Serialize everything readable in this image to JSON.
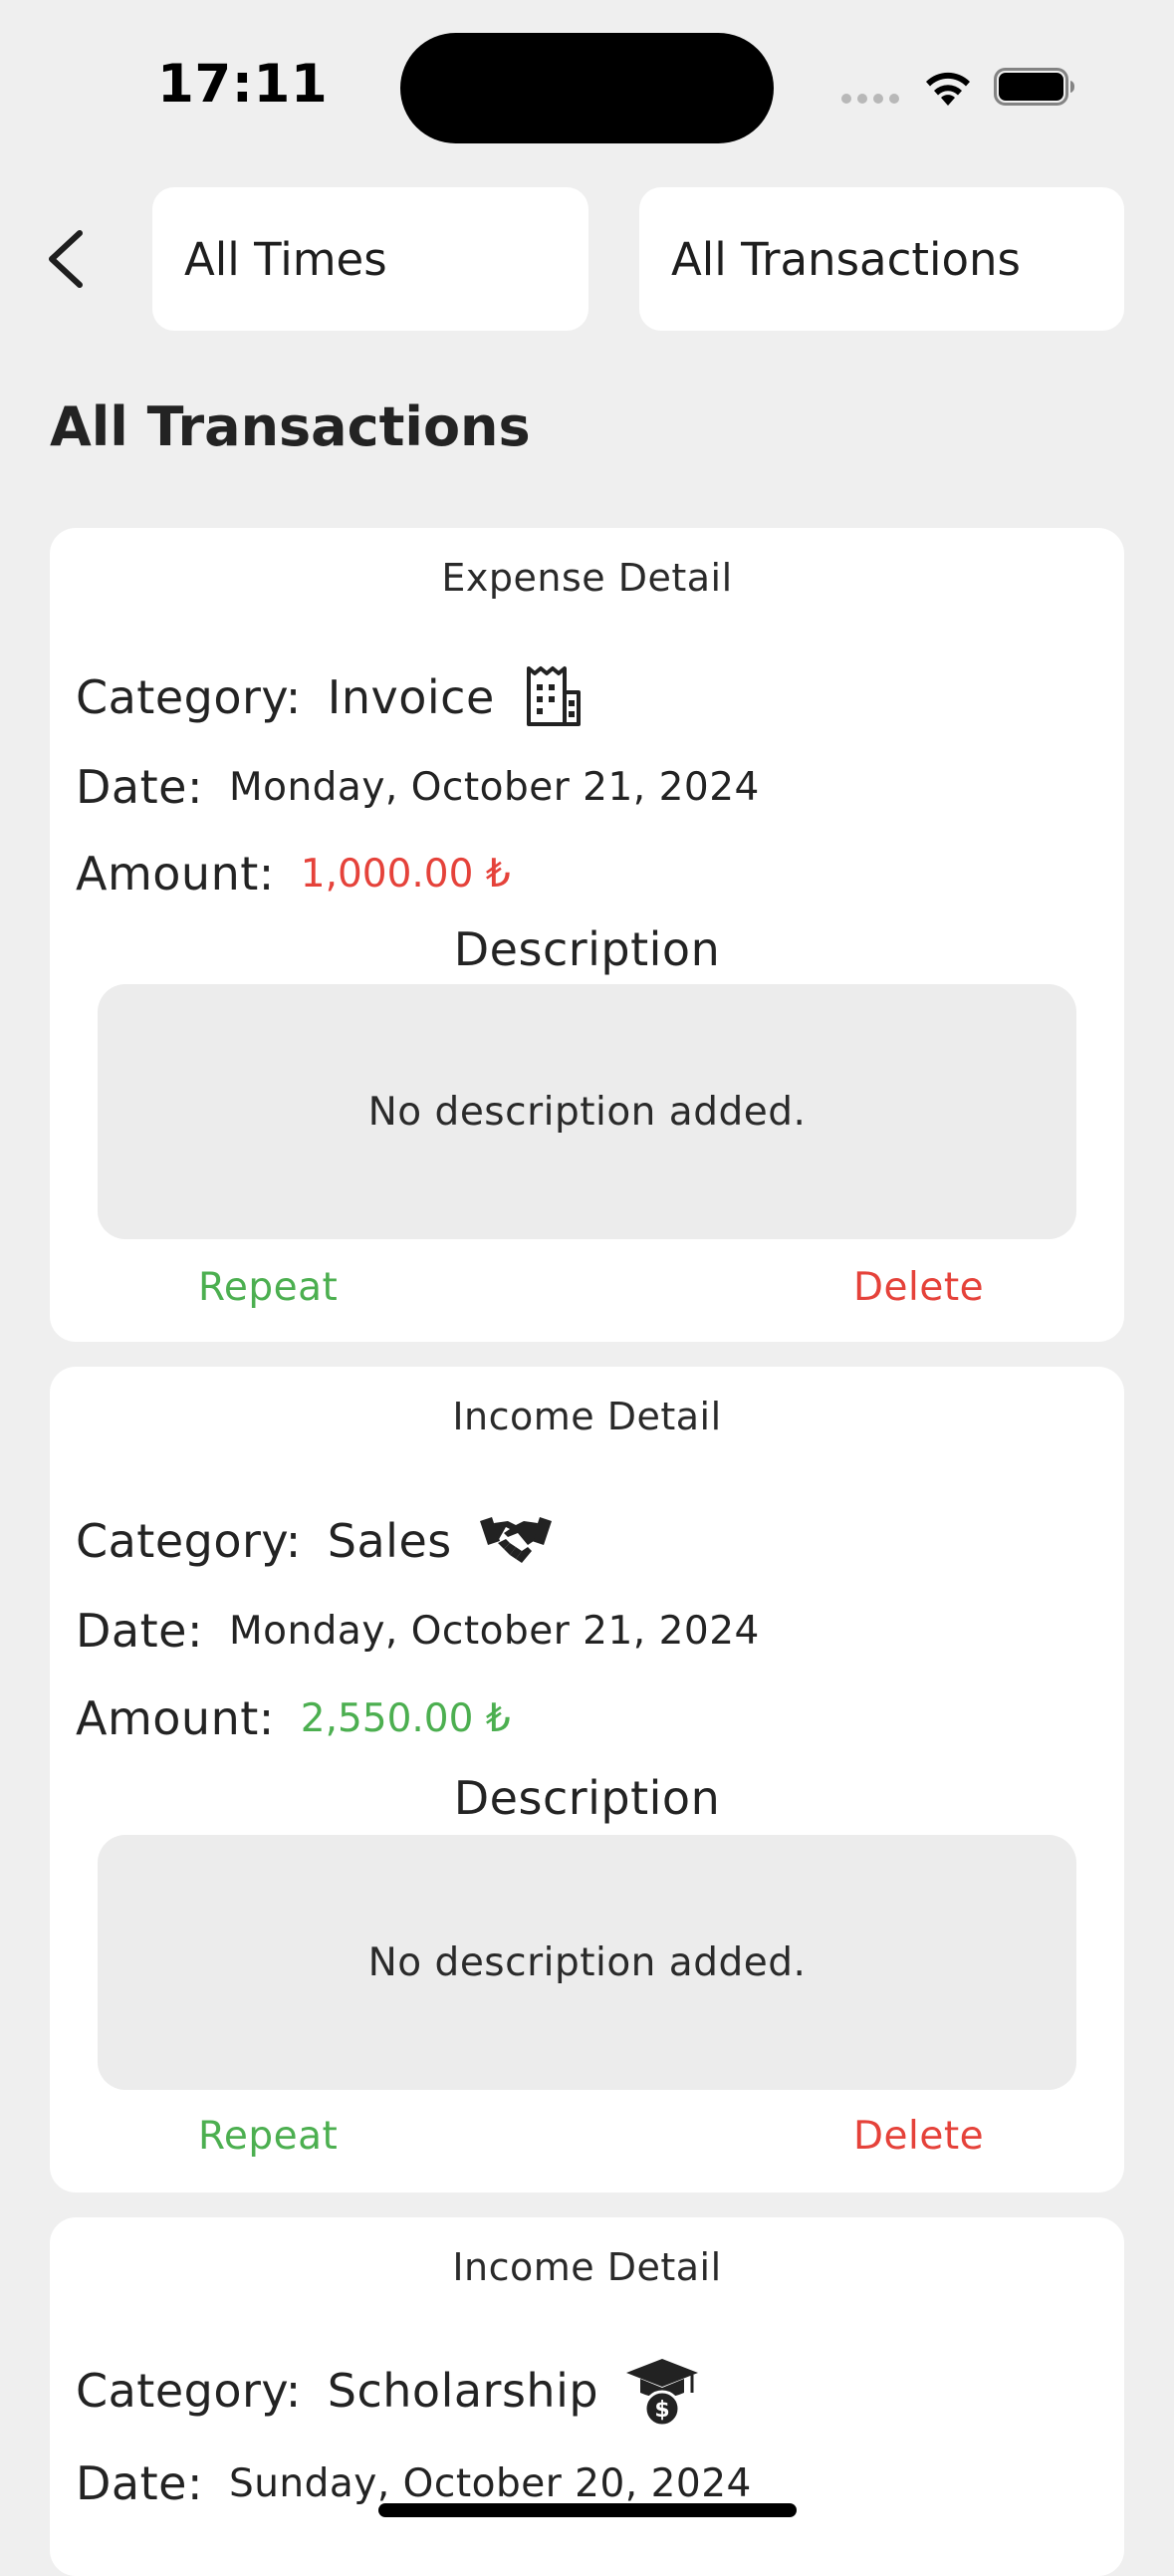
{
  "status_bar": {
    "time": "17:11"
  },
  "top_bar": {
    "back_icon": "chevron-left-icon",
    "time_filter": "All Times",
    "type_filter": "All Transactions"
  },
  "page": {
    "title": "All Transactions"
  },
  "labels": {
    "category": "Category:",
    "date": "Date:",
    "amount": "Amount:",
    "description": "Description",
    "repeat": "Repeat",
    "delete": "Delete"
  },
  "colors": {
    "expense": "#e5423a",
    "income": "#4caf50",
    "background": "#efefef"
  },
  "transactions": [
    {
      "heading": "Expense Detail",
      "category": "Invoice",
      "icon": "receipt-icon",
      "date": "Monday, October 21, 2024",
      "amount": "1,000.00 ₺",
      "kind": "expense",
      "description": "No description added."
    },
    {
      "heading": "Income Detail",
      "category": "Sales",
      "icon": "handshake-icon",
      "date": "Monday, October 21, 2024",
      "amount": "2,550.00 ₺",
      "kind": "income",
      "description": "No description added."
    },
    {
      "heading": "Income Detail",
      "category": "Scholarship",
      "icon": "graduation-cap-dollar-icon",
      "date": "Sunday, October 20, 2024"
    }
  ]
}
